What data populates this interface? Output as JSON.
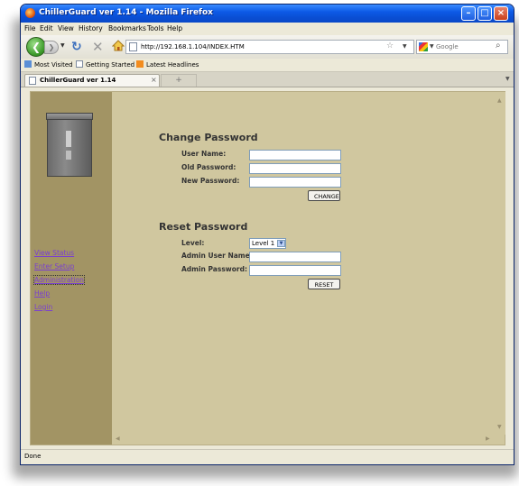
{
  "window": {
    "title": "ChillerGuard ver 1.14 - Mozilla Firefox"
  },
  "menu": [
    "File",
    "Edit",
    "View",
    "History",
    "Bookmarks",
    "Tools",
    "Help"
  ],
  "toolbar": {
    "url": "http://192.168.1.104/INDEX.HTM",
    "search_placeholder": "Google"
  },
  "bookmarks": [
    "Most Visited",
    "Getting Started",
    "Latest Headlines"
  ],
  "tab": {
    "label": "ChillerGuard ver 1.14"
  },
  "sidebar": {
    "links": [
      "View Status",
      "Enter Setup",
      "Administration",
      "Help",
      "Login"
    ]
  },
  "change_password": {
    "title": "Change Password",
    "labels": [
      "User Name:",
      "Old Password:",
      "New Password:"
    ],
    "button": "CHANGE"
  },
  "reset_password": {
    "title": "Reset Password",
    "level_label": "Level:",
    "level_value": "Level 1",
    "labels": [
      "Admin User Name:",
      "Admin Password:"
    ],
    "button": "RESET"
  },
  "status": {
    "text": "Done"
  },
  "colors": {
    "page_background": "#d0c79f",
    "sidebar": "#a29464",
    "link": "#7a3fd0",
    "titlebar": "#0a4fd4"
  },
  "icons": [
    "firefox-icon",
    "back-icon",
    "forward-icon",
    "reload-icon",
    "stop-icon",
    "home-icon",
    "bookmark-star-icon",
    "search-icon",
    "page-icon",
    "rss-icon",
    "chiller-unit-image"
  ]
}
